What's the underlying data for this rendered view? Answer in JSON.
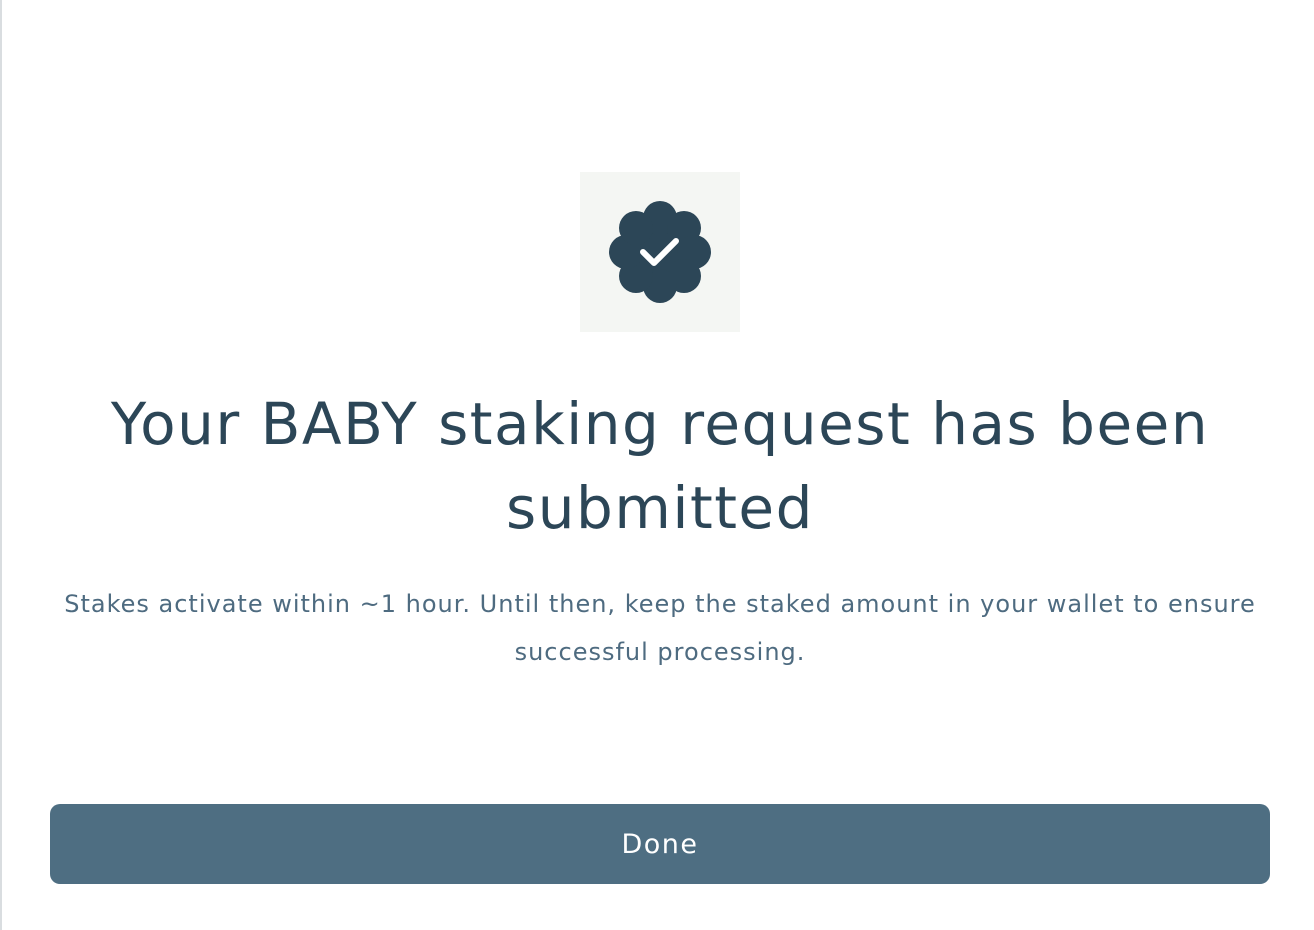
{
  "dialog": {
    "icon": "verified-badge-check-icon",
    "title": "Your BABY staking request has been submitted",
    "message": "Stakes activate within ~1 hour. Until then, keep the staked amount in your wallet to ensure successful processing.",
    "done_label": "Done"
  },
  "colors": {
    "icon_background": "#f4f6f3",
    "badge": "#2c4657",
    "title": "#2c4657",
    "message": "#4e6b80",
    "button": "#4e6e82",
    "button_text": "#ffffff"
  }
}
